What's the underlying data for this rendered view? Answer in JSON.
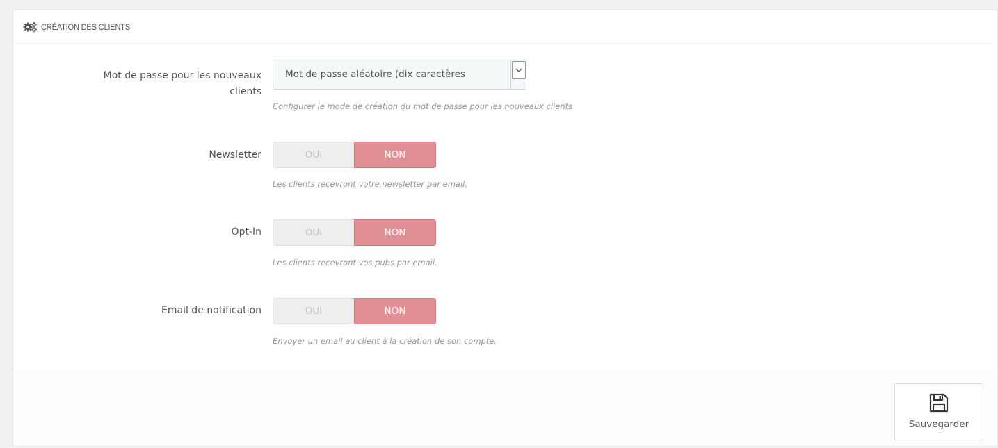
{
  "panel": {
    "heading": {
      "title": "CRÉATION DES CLIENTS",
      "icon": "cogs-icon"
    }
  },
  "fields": {
    "password": {
      "label_line1": "Mot de passe pour les nouveaux",
      "label_line2": "clients",
      "selected_value": "Mot de passe aléatoire (dix caractères",
      "help": "Configurer le mode de création du mot de passe pour les nouveaux clients"
    },
    "newsletter": {
      "label": "Newsletter",
      "yes_label": "OUI",
      "no_label": "NON",
      "value": "NON",
      "help": "Les clients recevront votre newsletter par email."
    },
    "optin": {
      "label": "Opt-In",
      "yes_label": "OUI",
      "no_label": "NON",
      "value": "NON",
      "help": "Les clients recevront vos pubs par email."
    },
    "notification": {
      "label": "Email de notification",
      "yes_label": "OUI",
      "no_label": "NON",
      "value": "NON",
      "help": "Envoyer un email au client à la création de son compte."
    }
  },
  "footer": {
    "save_label": "Sauvegarder",
    "save_icon": "floppy-disk-icon"
  },
  "colors": {
    "switch_active": "#e08f95",
    "switch_inactive": "#eeeeee"
  }
}
